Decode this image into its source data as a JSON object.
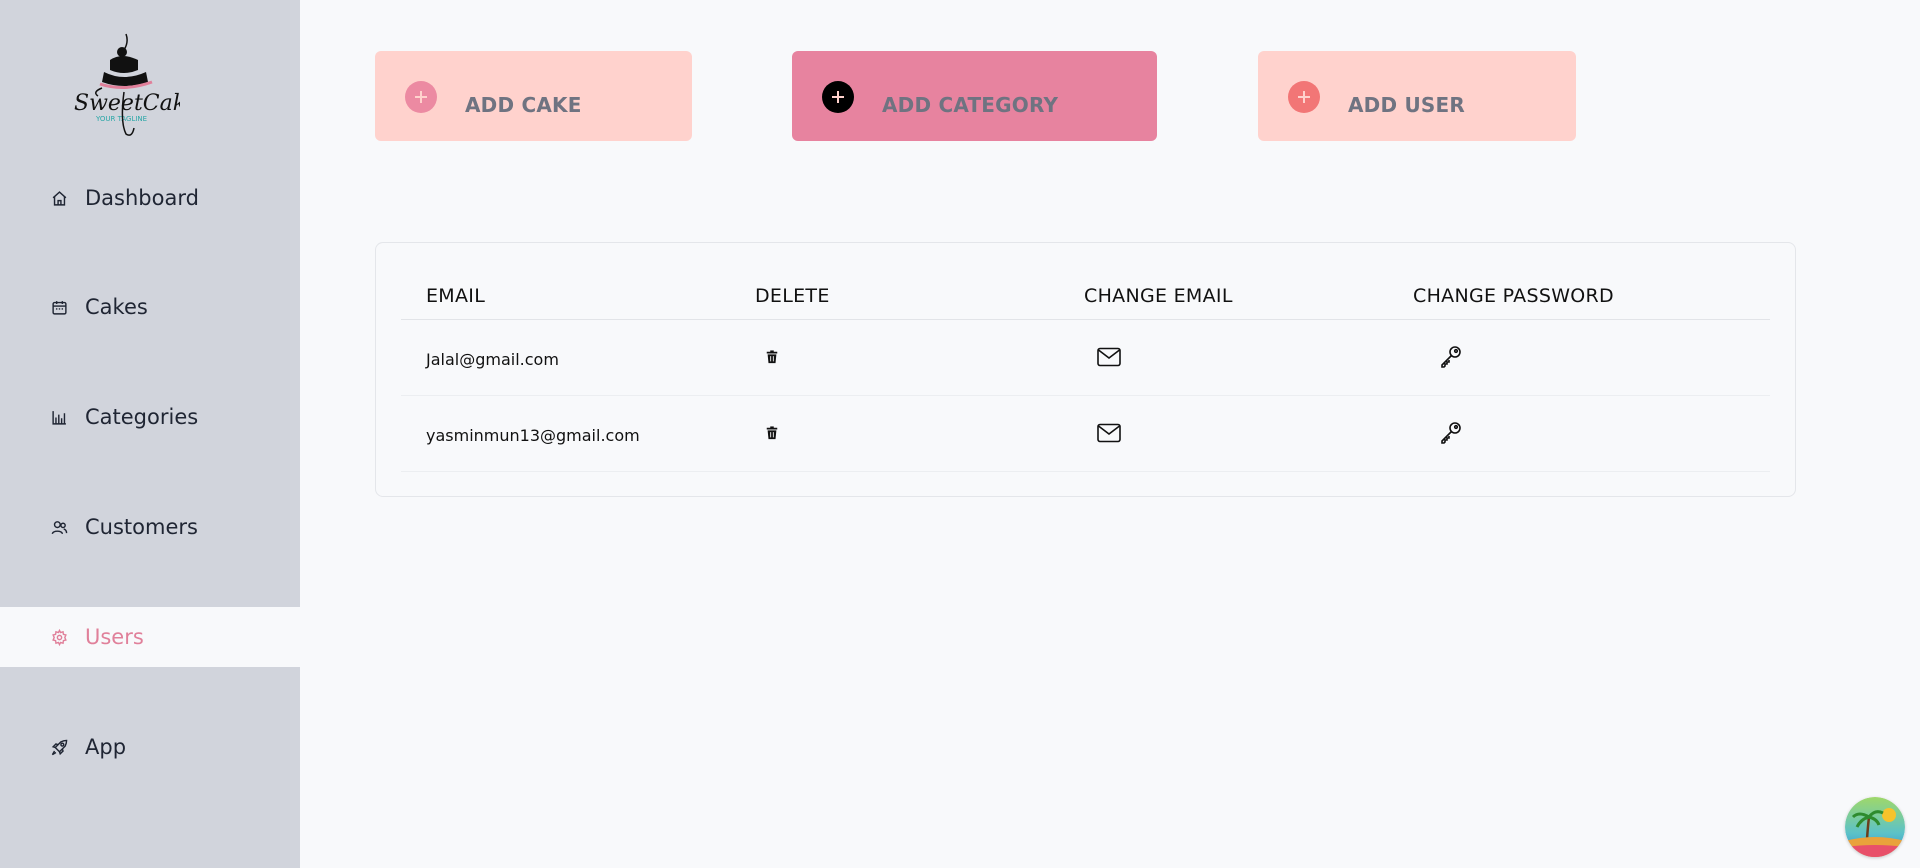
{
  "brand": {
    "name": "SweetCake",
    "tagline": "YOUR TAGLINE"
  },
  "sidebar": {
    "items": [
      {
        "label": "Dashboard",
        "icon": "home-icon"
      },
      {
        "label": "Cakes",
        "icon": "calendar-icon"
      },
      {
        "label": "Categories",
        "icon": "chart-icon"
      },
      {
        "label": "Customers",
        "icon": "users-icon"
      },
      {
        "label": "Users",
        "icon": "gear-icon",
        "active": true
      },
      {
        "label": "App",
        "icon": "rocket-icon"
      }
    ]
  },
  "actions": [
    {
      "label": "ADD CAKE",
      "icon": "plus-icon"
    },
    {
      "label": "ADD CATEGORY",
      "icon": "plus-icon"
    },
    {
      "label": "ADD USER",
      "icon": "plus-icon"
    }
  ],
  "users_table": {
    "headers": [
      "EMAIL",
      "DELETE",
      "CHANGE EMAIL",
      "CHANGE PASSWORD"
    ],
    "rows": [
      {
        "email": "Jalal@gmail.com"
      },
      {
        "email": "yasminmun13@gmail.com"
      }
    ]
  },
  "colors": {
    "sidebar_bg": "#d1d4dc",
    "active_accent": "#e0809a",
    "card_light": "#ffd2cd",
    "card_active": "#e7839f"
  }
}
